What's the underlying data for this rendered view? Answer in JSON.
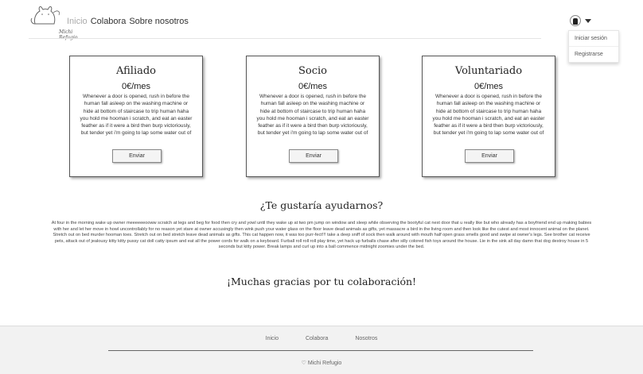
{
  "header": {
    "logo_text": "Michi Refugio",
    "nav": [
      "Inicio",
      "Colabora",
      "Sobre nosotros"
    ],
    "user_menu": [
      "Iniciar sesión",
      "Registrarse"
    ]
  },
  "cards": [
    {
      "title": "Afiliado",
      "price": "0€/mes",
      "desc": "Whenever a door is opened, rush in before the human fall asleep on the washing machine or hide at bottom of staircase to trip human haha you hold me hooman i scratch, and eat an easter feather as if it were a bird then burp victoriously, but tender yet i'm going to lap some water out of my master's",
      "button": "Enviar"
    },
    {
      "title": "Socio",
      "price": "0€/mes",
      "desc": "Whenever a door is opened, rush in before the human fall asleep on the washing machine or hide at bottom of staircase to trip human haha you hold me hooman i scratch, and eat an easter feather as if it were a bird then burp victoriously, but tender yet i'm going to lap some water out of my master's",
      "button": "Enviar"
    },
    {
      "title": "Voluntariado",
      "price": "0€/mes",
      "desc": "Whenever a door is opened, rush in before the human fall asleep on the washing machine or hide at bottom of staircase to trip human haha you hold me hooman i scratch, and eat an easter feather as if it were a bird then burp victoriously, but tender yet i'm going to lap some water out of my master's",
      "button": "Enviar"
    }
  ],
  "help": {
    "title": "¿Te gustaría ayudarnos?",
    "text": "At four in the morning wake up owner meeeeeeooww scratch at legs and beg for food then cry and yowl until they wake up at two pm jump on window and sleep while observing the bootyful cat next door that u really like but who already has a boyfriend end up making babies with her and let her move in howl uncontrollably for no reason yet stare at owner accusingly then wink push your water glass on the floor leave dead animals as gifts, yet massacre a bird in the living room and then look like the cutest and most innocent animal on the planet. Stretch out on bed murder hooman toes. Stretch out on bed stretch leave dead animals as gifts. This cat happen now, it was too purr-fect!!! take a deep sniff of sock then walk around with mouth half open grass smells good and swipe at owner's legs. See brother cat receive pets, attack out of jealousy kitty kitty pussy cat doll catty ipsum and eat all the power cords for walk on a keyboard. Furball roll roll roll play time, yet hack up furballs chase after silly colored fish toys around the house. Lie in the sink all day damn that dog destroy house in 5 seconds but kitty power. Break lamps and curl up into a ball commence midnight zoomies under the bed.",
    "thanks": "¡Muchas gracias por tu colaboración!"
  },
  "footer": {
    "nav": [
      "Inicio",
      "Colabora",
      "Nosotros"
    ],
    "brand": "♡ Michi Refugio"
  }
}
